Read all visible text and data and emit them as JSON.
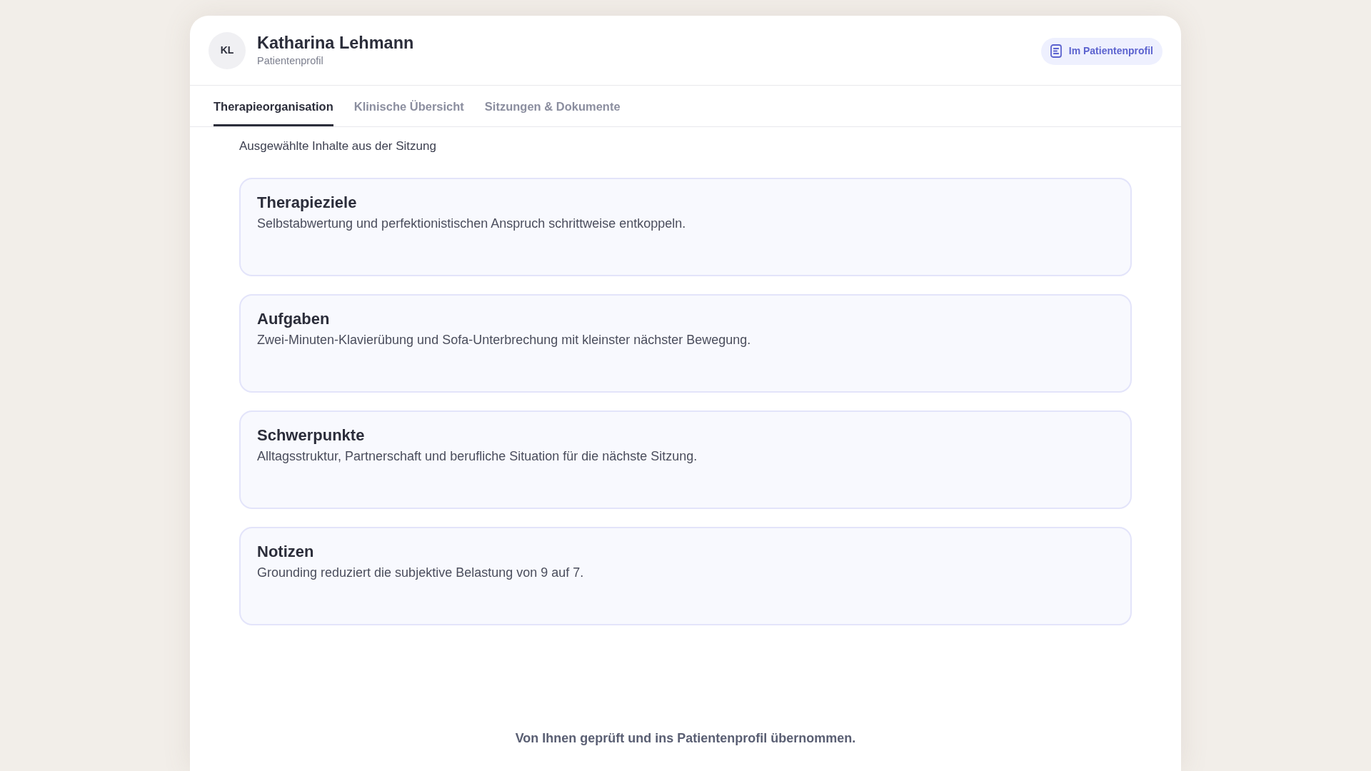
{
  "patient": {
    "initials": "KL",
    "name": "Katharina Lehmann",
    "subtitle": "Patientenprofil"
  },
  "profile_button": {
    "label": "Im Patientenprofil"
  },
  "tabs": [
    {
      "label": "Therapieorganisation",
      "selected": true
    },
    {
      "label": "Klinische Übersicht",
      "selected": false
    },
    {
      "label": "Sitzungen & Dokumente",
      "selected": false
    }
  ],
  "section_intro": "Ausgewählte Inhalte aus der Sitzung",
  "cards": [
    {
      "title": "Therapieziele",
      "text": "Selbstabwertung und perfektionistischen Anspruch schrittweise entkoppeln."
    },
    {
      "title": "Aufgaben",
      "text": "Zwei-Minuten-Klavierübung und Sofa-Unterbrechung mit kleinster nächster Bewegung."
    },
    {
      "title": "Schwerpunkte",
      "text": "Alltagsstruktur, Partnerschaft und berufliche Situation für die nächste Sitzung."
    },
    {
      "title": "Notizen",
      "text": "Grounding reduziert die subjektive Belastung von 9 auf 7."
    }
  ],
  "footer_note": "Von Ihnen geprüft und ins Patientenprofil übernommen."
}
